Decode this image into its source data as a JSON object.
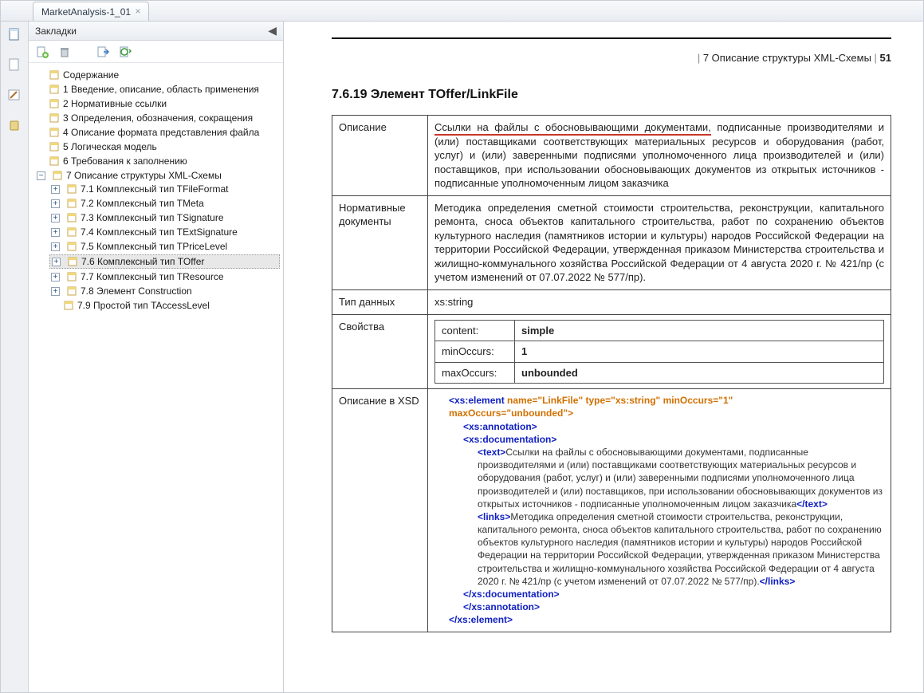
{
  "tab": {
    "title": "MarketAnalysis-1_01"
  },
  "sidebar": {
    "title": "Закладки",
    "items": [
      {
        "label": "Содержание"
      },
      {
        "label": "1 Введение, описание, область применения"
      },
      {
        "label": "2 Нормативные ссылки"
      },
      {
        "label": "3 Определения, обозначения, сокращения"
      },
      {
        "label": "4 Описание формата представления файла"
      },
      {
        "label": "5 Логическая модель"
      },
      {
        "label": "6 Требования к заполнению"
      }
    ],
    "section7": {
      "label": "7 Описание структуры XML-Схемы",
      "children": [
        {
          "label": "7.1 Комплексный тип TFileFormat"
        },
        {
          "label": "7.2 Комплексный тип TMeta"
        },
        {
          "label": "7.3 Комплексный тип TSignature"
        },
        {
          "label": "7.4 Комплексный тип TExtSignature"
        },
        {
          "label": "7.5 Комплексный тип TPriceLevel"
        },
        {
          "label": "7.6 Комплексный тип TOffer",
          "selected": true
        },
        {
          "label": "7.7 Комплексный тип TResource"
        },
        {
          "label": "7.8 Элемент Construction"
        },
        {
          "label": "7.9 Простой тип TAccessLevel"
        }
      ]
    }
  },
  "page": {
    "header_section": "7 Описание структуры XML-Схемы",
    "header_page": "51",
    "section_title": "7.6.19 Элемент TOffer/LinkFile",
    "rows": {
      "desc_label": "Описание",
      "desc_hl": "Ссылки на файлы с обосновывающими документами,",
      "desc_rest": " подписанные производителями и (или) поставщиками соответствующих материальных ресурсов и оборудования (работ, услуг) и (или) заверенными подписями уполномоченного лица производителей и (или) поставщиков, при использовании обосновывающих документов из открытых источников - подписанные уполномоченным лицом заказчика",
      "norm_label": "Нормативные документы",
      "norm_text": "Методика определения сметной стоимости строительства, реконструкции, капитального ремонта, сноса объектов капитального строительства, работ по сохранению объектов культурного наследия (памятников истории и культуры) народов Российской Федерации на территории Российской Федерации, утвержденная приказом Министерства строительства и жилищно-коммунального хозяйства Российской Федерации от 4 августа 2020 г. № 421/пр (с учетом изменений от 07.07.2022 № 577/пр).",
      "type_label": "Тип данных",
      "type_value": "xs:string",
      "props_label": "Свойства",
      "props": {
        "content_k": "content:",
        "content_v": "simple",
        "min_k": "minOccurs:",
        "min_v": "1",
        "max_k": "maxOccurs:",
        "max_v": "unbounded"
      },
      "xsd_label": "Описание в XSD"
    },
    "code": {
      "l1_a": "<xs:element",
      "l1_b": "name",
      "l1_c": "=\"LinkFile\" ",
      "l1_d": "type",
      "l1_e": "=\"xs:string\" ",
      "l1_f": "minOccurs",
      "l1_g": "=\"1\"",
      "l2_a": "maxOccurs",
      "l2_b": "=\"unbounded\">",
      "l3": "<xs:annotation>",
      "l4": "<xs:documentation>",
      "l5_a": "<text>",
      "l5_b": "Ссылки на файлы с обосновывающими документами, подписанные производителями и (или) поставщиками соответствующих материальных ресурсов и оборудования (работ, услуг) и (или) заверенными подписями уполномоченного лица производителей и (или) поставщиков, при использовании обосновывающих документов из открытых источников - подписанные уполномоченным лицом заказчика",
      "l5_c": "</text>",
      "l6_a": "<links>",
      "l6_b": "Методика определения сметной стоимости строительства, реконструкции, капитального ремонта, сноса объектов капитального строительства, работ по сохранению объектов культурного наследия (памятников истории и культуры) народов Российской Федерации на территории Российской Федерации, утвержденная приказом Министерства строительства и жилищно-коммунального хозяйства Российской Федерации от 4 августа 2020 г. № 421/пр (с учетом изменений от 07.07.2022 № 577/пр).",
      "l6_c": "</links>",
      "l7": "</xs:documentation>",
      "l8": "</xs:annotation>",
      "l9": "</xs:element>"
    }
  }
}
